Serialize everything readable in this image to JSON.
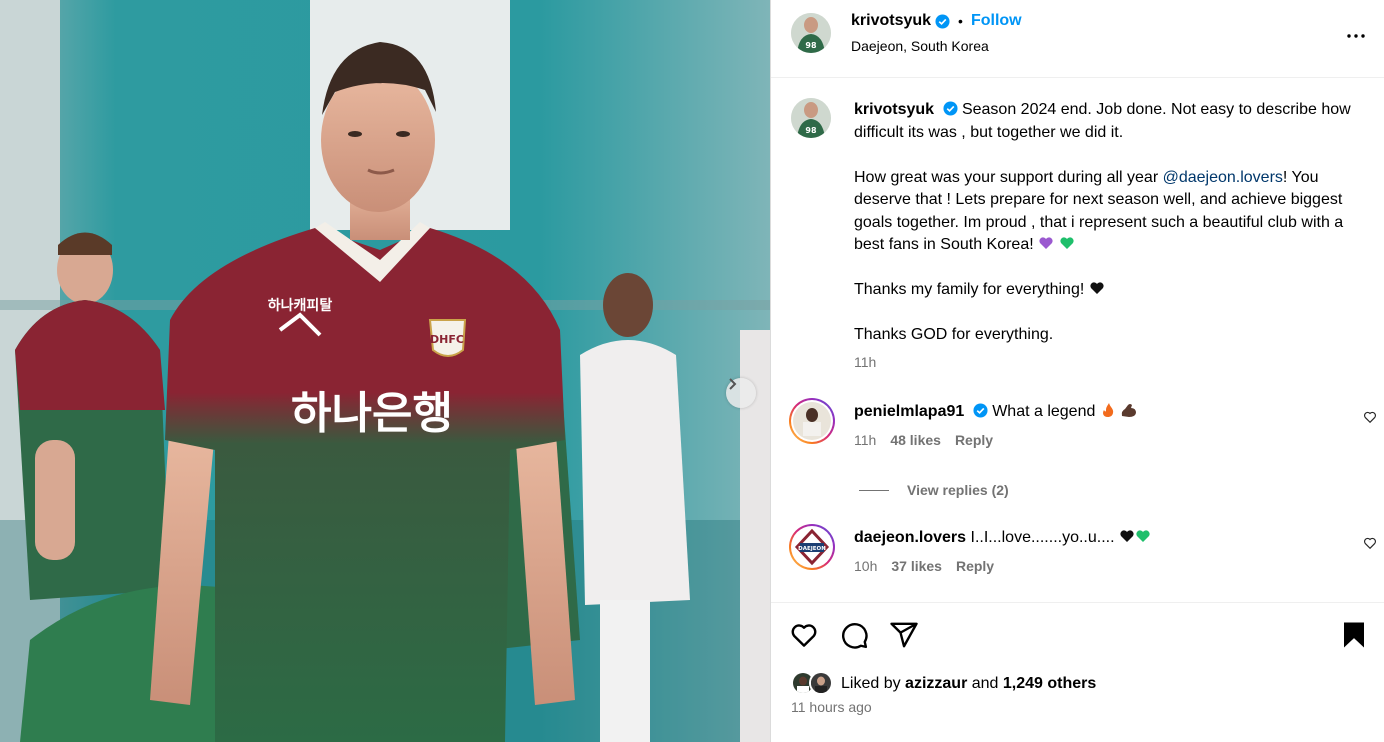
{
  "post": {
    "author": {
      "username": "krivotsyuk",
      "follow_label": "Follow",
      "location": "Daejeon, South Korea",
      "dot": "•"
    },
    "caption": {
      "username": "krivotsyuk",
      "line1": "Season 2024 end. Job done. Not easy to describe how difficult its was , but together we did it.",
      "p2_before": "How great was your support during all year ",
      "p2_mention": "@daejeon.lovers",
      "p2_after": "! You deserve that ! Lets prepare for next season well, and achieve biggest goals together. Im proud , that i represent such a beautiful club with a best fans in South Korea!",
      "p3": "Thanks my family for everything!",
      "p4": "Thanks GOD for everything.",
      "time": "11h"
    },
    "comments": [
      {
        "username": "penielmlapa91",
        "text": "What a legend",
        "time": "11h",
        "likes": "48 likes",
        "reply": "Reply",
        "view_replies": "View replies (2)"
      },
      {
        "username": "daejeon.lovers",
        "text": "I..I...love.......yo..u....",
        "time": "10h",
        "likes": "37 likes",
        "reply": "Reply",
        "avatar_text": "DAEJEON\nLOVERS"
      }
    ],
    "likes": {
      "prefix": "Liked by",
      "first": "azizzaur",
      "and": "and",
      "others": "1,249 others"
    },
    "posted": "11 hours ago",
    "media": {
      "jersey_sponsor": "하나은행",
      "jersey_top_sponsor": "하나캐피탈",
      "club_badge": "DHFC"
    }
  },
  "colors": {
    "link": "#0095f6",
    "mention": "#00376b",
    "jersey_red": "#8a2433",
    "jersey_green": "#2c6b45"
  }
}
